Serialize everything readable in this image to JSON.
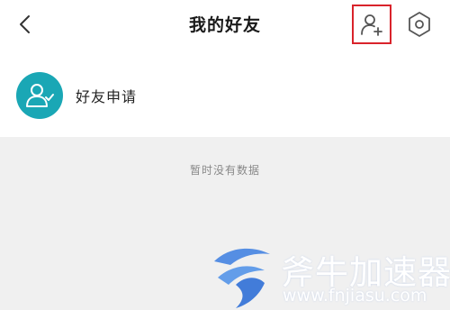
{
  "header": {
    "title": "我的好友",
    "back_icon": "chevron-left-icon",
    "add_friend_icon": "user-add-icon",
    "settings_icon": "hexagon-settings-icon",
    "highlight_color": "#d9232b"
  },
  "friend_request": {
    "label": "好友申请",
    "icon": "user-check-icon",
    "avatar_color": "#1aa7b5"
  },
  "empty_state": {
    "text": "暂时没有数据"
  },
  "watermark": {
    "brand": "斧牛加速器",
    "url": "www.fnjiasu.com"
  }
}
